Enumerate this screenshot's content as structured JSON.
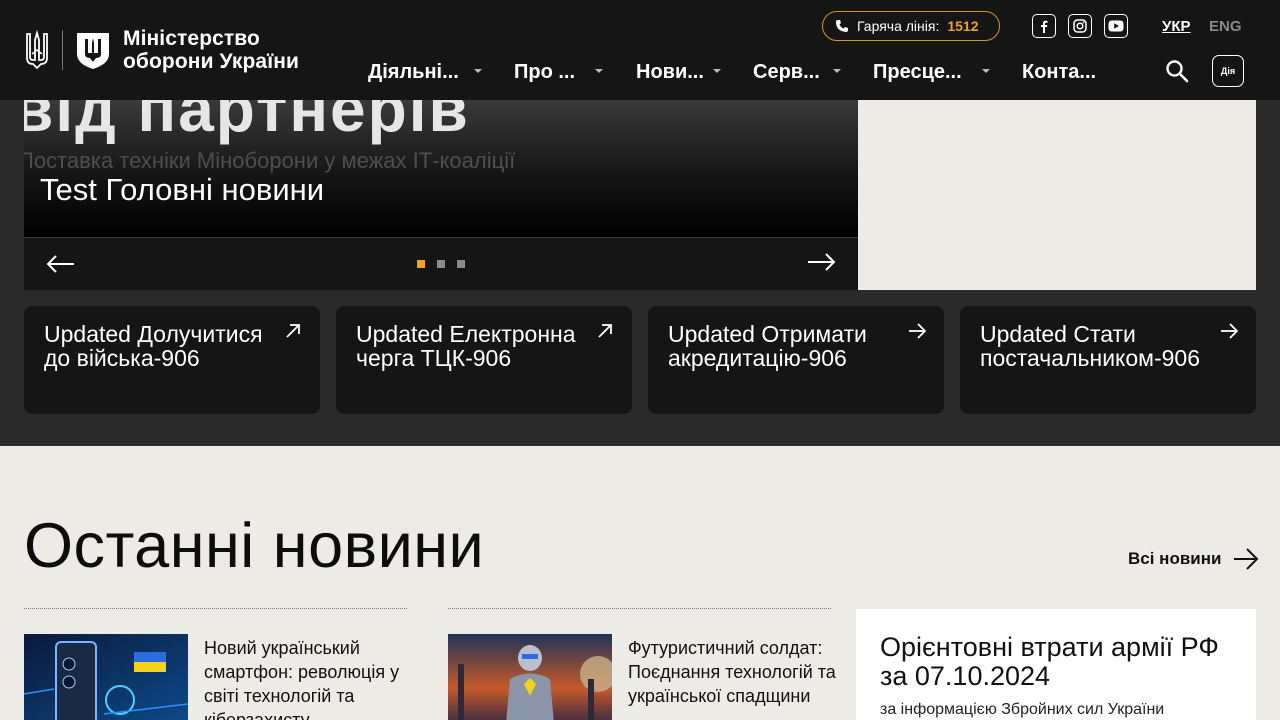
{
  "header": {
    "logo_line1": "Міністерство",
    "logo_line2": "оборони України",
    "hotline_label": "Гаряча лінія:",
    "hotline_number": "1512",
    "lang_active": "УКР",
    "lang_inactive": "ENG",
    "diia_label": "Дія",
    "social_icons": [
      "facebook-icon",
      "instagram-icon",
      "youtube-icon"
    ],
    "nav": [
      {
        "label": "Діяльні..."
      },
      {
        "label": "Про ..."
      },
      {
        "label": "Нови..."
      },
      {
        "label": "Серв..."
      },
      {
        "label": "Пресце..."
      },
      {
        "label": "Конта..."
      }
    ]
  },
  "hero": {
    "image_big_text": "від партнерів",
    "image_sub_text": "Поставка техніки Міноборони у межах ІТ-коаліції",
    "slide_title": "Test Головні новини",
    "slides_count": 3,
    "active_slide": 1
  },
  "quick_links": [
    {
      "label": "Updated Долучитися до війська-906",
      "icon": "arrow-up-right-icon"
    },
    {
      "label": "Updated Електронна черга ТЦК-906",
      "icon": "arrow-up-right-icon"
    },
    {
      "label": "Updated Отримати акредитацію-906",
      "icon": "arrow-right-icon"
    },
    {
      "label": "Updated Стати постачальником-906",
      "icon": "arrow-right-icon"
    }
  ],
  "news": {
    "heading": "Останні новини",
    "all_link": "Всі новини",
    "items": [
      {
        "title": "Новий український смартфон: революція у світі технологій та кіберзахисту"
      },
      {
        "title": "Футуристичний солдат: Поєднання технологій та української спадщини"
      }
    ],
    "losses": {
      "title": "Орієнтовні втрати армії РФ за 07.10.2024",
      "subtitle": "за інформацією Збройних сил України"
    }
  },
  "colors": {
    "header_bg": "#151515",
    "accent": "#f0a21e",
    "page_bg": "#ecebe6"
  }
}
